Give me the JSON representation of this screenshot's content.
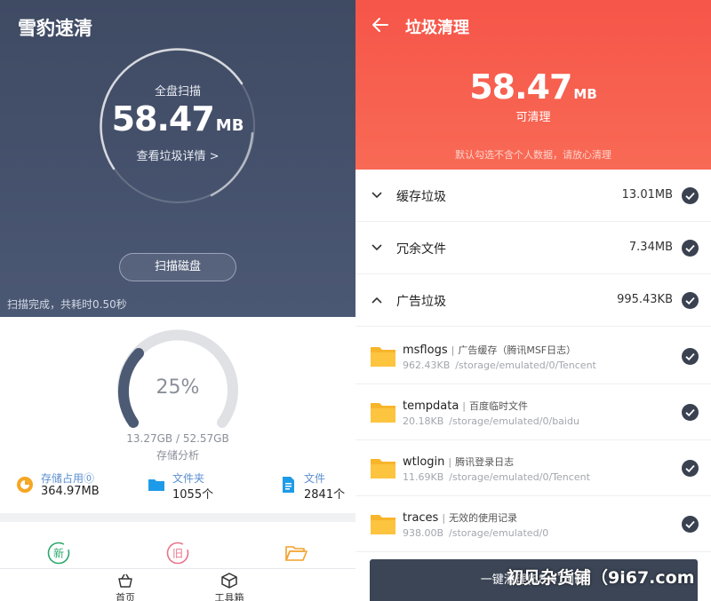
{
  "left": {
    "app_title": "雪豹速清",
    "scan_label": "全盘扫描",
    "junk_size": "58.47",
    "junk_unit": "MB",
    "details_link": "查看垃圾详情 >",
    "scan_button": "扫描磁盘",
    "scan_status": "扫描完成，共耗时0.50秒",
    "storage": {
      "percent_text": "25%",
      "percent": 25,
      "used_total": "13.27GB / 52.57GB",
      "label": "存储分析"
    },
    "stats": [
      {
        "label": "存储占用⓪",
        "value": "364.97MB",
        "icon": "storage-pie-icon"
      },
      {
        "label": "文件夹",
        "value": "1055个",
        "icon": "folder-icon"
      },
      {
        "label": "文件",
        "value": "2841个",
        "icon": "document-icon"
      }
    ],
    "tools": [
      {
        "glyph": "新",
        "icon": "new-files-icon",
        "color": "#2aa86b"
      },
      {
        "glyph": "旧",
        "icon": "old-files-icon",
        "color": "#e8748c"
      },
      {
        "icon": "open-folder-icon",
        "color": "#f2a12a"
      }
    ],
    "nav": [
      {
        "label": "首页",
        "icon": "home-basket-icon"
      },
      {
        "label": "工具箱",
        "icon": "toolbox-cube-icon"
      }
    ]
  },
  "right": {
    "title": "垃圾清理",
    "total_size": "58.47",
    "total_unit": "MB",
    "cleanable_label": "可清理",
    "hint": "默认勾选不含个人数据，请放心清理",
    "categories": [
      {
        "name": "缓存垃圾",
        "size": "13.01MB",
        "expanded": false
      },
      {
        "name": "冗余文件",
        "size": "7.34MB",
        "expanded": false
      },
      {
        "name": "广告垃圾",
        "size": "995.43KB",
        "expanded": true
      }
    ],
    "items": [
      {
        "name": "msflogs",
        "desc": "广告缓存（腾讯MSF日志）",
        "size": "962.43KB",
        "path": "/storage/emulated/0/Tencent"
      },
      {
        "name": "tempdata",
        "desc": "百度临时文件",
        "size": "20.18KB",
        "path": "/storage/emulated/0/baidu"
      },
      {
        "name": "wtlogin",
        "desc": "腾讯登录日志",
        "size": "11.69KB",
        "path": "/storage/emulated/0/Tencent"
      },
      {
        "name": "traces",
        "desc": "无效的使用记录",
        "size": "938.00B",
        "path": "/storage/emulated/0"
      }
    ],
    "clean_button": "一键清理(58.47MB)"
  },
  "watermark": "初见杂货铺（9i67.com",
  "colors": {
    "left_header": "#3f4a63",
    "right_header": "#f65549",
    "folder": "#f9b52a",
    "check": "#3a4150",
    "clean_button": "#3b4556"
  }
}
